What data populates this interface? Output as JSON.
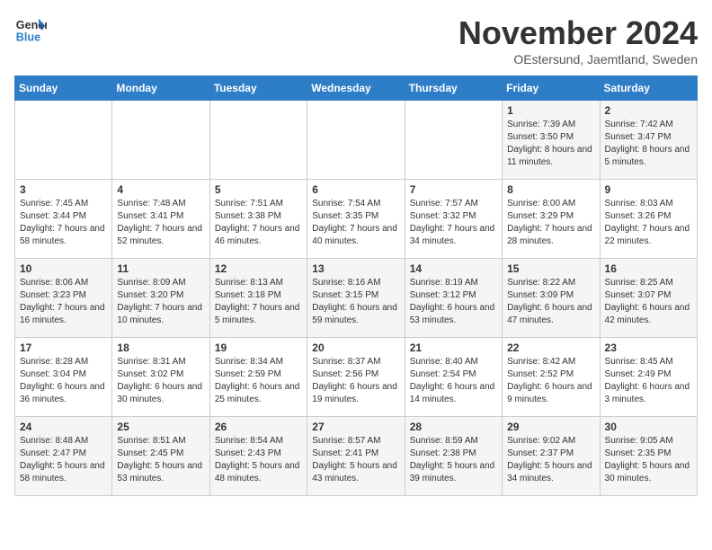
{
  "logo": {
    "line1": "General",
    "line2": "Blue"
  },
  "title": "November 2024",
  "subtitle": "OEstersund, Jaemtland, Sweden",
  "days_of_week": [
    "Sunday",
    "Monday",
    "Tuesday",
    "Wednesday",
    "Thursday",
    "Friday",
    "Saturday"
  ],
  "weeks": [
    [
      {
        "day": "",
        "info": ""
      },
      {
        "day": "",
        "info": ""
      },
      {
        "day": "",
        "info": ""
      },
      {
        "day": "",
        "info": ""
      },
      {
        "day": "",
        "info": ""
      },
      {
        "day": "1",
        "info": "Sunrise: 7:39 AM\nSunset: 3:50 PM\nDaylight: 8 hours and 11 minutes."
      },
      {
        "day": "2",
        "info": "Sunrise: 7:42 AM\nSunset: 3:47 PM\nDaylight: 8 hours and 5 minutes."
      }
    ],
    [
      {
        "day": "3",
        "info": "Sunrise: 7:45 AM\nSunset: 3:44 PM\nDaylight: 7 hours and 58 minutes."
      },
      {
        "day": "4",
        "info": "Sunrise: 7:48 AM\nSunset: 3:41 PM\nDaylight: 7 hours and 52 minutes."
      },
      {
        "day": "5",
        "info": "Sunrise: 7:51 AM\nSunset: 3:38 PM\nDaylight: 7 hours and 46 minutes."
      },
      {
        "day": "6",
        "info": "Sunrise: 7:54 AM\nSunset: 3:35 PM\nDaylight: 7 hours and 40 minutes."
      },
      {
        "day": "7",
        "info": "Sunrise: 7:57 AM\nSunset: 3:32 PM\nDaylight: 7 hours and 34 minutes."
      },
      {
        "day": "8",
        "info": "Sunrise: 8:00 AM\nSunset: 3:29 PM\nDaylight: 7 hours and 28 minutes."
      },
      {
        "day": "9",
        "info": "Sunrise: 8:03 AM\nSunset: 3:26 PM\nDaylight: 7 hours and 22 minutes."
      }
    ],
    [
      {
        "day": "10",
        "info": "Sunrise: 8:06 AM\nSunset: 3:23 PM\nDaylight: 7 hours and 16 minutes."
      },
      {
        "day": "11",
        "info": "Sunrise: 8:09 AM\nSunset: 3:20 PM\nDaylight: 7 hours and 10 minutes."
      },
      {
        "day": "12",
        "info": "Sunrise: 8:13 AM\nSunset: 3:18 PM\nDaylight: 7 hours and 5 minutes."
      },
      {
        "day": "13",
        "info": "Sunrise: 8:16 AM\nSunset: 3:15 PM\nDaylight: 6 hours and 59 minutes."
      },
      {
        "day": "14",
        "info": "Sunrise: 8:19 AM\nSunset: 3:12 PM\nDaylight: 6 hours and 53 minutes."
      },
      {
        "day": "15",
        "info": "Sunrise: 8:22 AM\nSunset: 3:09 PM\nDaylight: 6 hours and 47 minutes."
      },
      {
        "day": "16",
        "info": "Sunrise: 8:25 AM\nSunset: 3:07 PM\nDaylight: 6 hours and 42 minutes."
      }
    ],
    [
      {
        "day": "17",
        "info": "Sunrise: 8:28 AM\nSunset: 3:04 PM\nDaylight: 6 hours and 36 minutes."
      },
      {
        "day": "18",
        "info": "Sunrise: 8:31 AM\nSunset: 3:02 PM\nDaylight: 6 hours and 30 minutes."
      },
      {
        "day": "19",
        "info": "Sunrise: 8:34 AM\nSunset: 2:59 PM\nDaylight: 6 hours and 25 minutes."
      },
      {
        "day": "20",
        "info": "Sunrise: 8:37 AM\nSunset: 2:56 PM\nDaylight: 6 hours and 19 minutes."
      },
      {
        "day": "21",
        "info": "Sunrise: 8:40 AM\nSunset: 2:54 PM\nDaylight: 6 hours and 14 minutes."
      },
      {
        "day": "22",
        "info": "Sunrise: 8:42 AM\nSunset: 2:52 PM\nDaylight: 6 hours and 9 minutes."
      },
      {
        "day": "23",
        "info": "Sunrise: 8:45 AM\nSunset: 2:49 PM\nDaylight: 6 hours and 3 minutes."
      }
    ],
    [
      {
        "day": "24",
        "info": "Sunrise: 8:48 AM\nSunset: 2:47 PM\nDaylight: 5 hours and 58 minutes."
      },
      {
        "day": "25",
        "info": "Sunrise: 8:51 AM\nSunset: 2:45 PM\nDaylight: 5 hours and 53 minutes."
      },
      {
        "day": "26",
        "info": "Sunrise: 8:54 AM\nSunset: 2:43 PM\nDaylight: 5 hours and 48 minutes."
      },
      {
        "day": "27",
        "info": "Sunrise: 8:57 AM\nSunset: 2:41 PM\nDaylight: 5 hours and 43 minutes."
      },
      {
        "day": "28",
        "info": "Sunrise: 8:59 AM\nSunset: 2:38 PM\nDaylight: 5 hours and 39 minutes."
      },
      {
        "day": "29",
        "info": "Sunrise: 9:02 AM\nSunset: 2:37 PM\nDaylight: 5 hours and 34 minutes."
      },
      {
        "day": "30",
        "info": "Sunrise: 9:05 AM\nSunset: 2:35 PM\nDaylight: 5 hours and 30 minutes."
      }
    ]
  ]
}
